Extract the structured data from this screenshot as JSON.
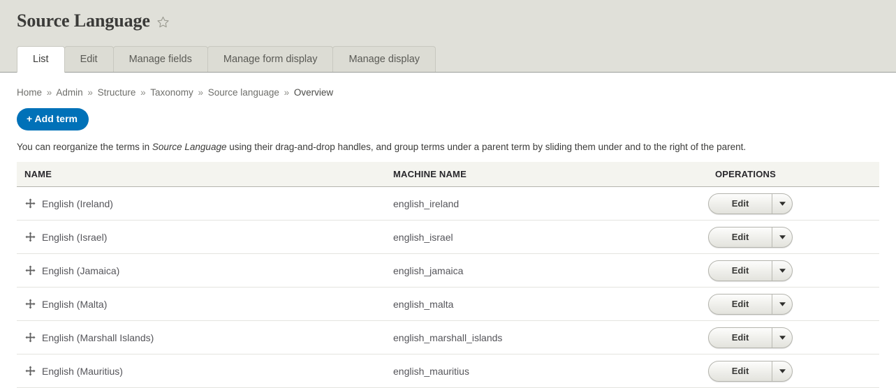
{
  "header": {
    "title": "Source Language",
    "favorite_icon": "star-outline-icon"
  },
  "tabs": [
    {
      "label": "List",
      "active": true
    },
    {
      "label": "Edit",
      "active": false
    },
    {
      "label": "Manage fields",
      "active": false
    },
    {
      "label": "Manage form display",
      "active": false
    },
    {
      "label": "Manage display",
      "active": false
    }
  ],
  "breadcrumb": {
    "separator": "»",
    "items": [
      "Home",
      "Admin",
      "Structure",
      "Taxonomy",
      "Source language",
      "Overview"
    ]
  },
  "actions": {
    "add_term_label": "+ Add term",
    "add_term_color": "#0071b8"
  },
  "help": {
    "before": "You can reorganize the terms in ",
    "emphasis": "Source Language",
    "after": " using their drag-and-drop handles, and group terms under a parent term by sliding them under and to the right of the parent."
  },
  "table": {
    "columns": [
      "NAME",
      "MACHINE NAME",
      "OPERATIONS"
    ],
    "drag_icon": "move-cross-icon",
    "operation_label": "Edit",
    "operation_toggle_icon": "chevron-down-icon",
    "rows": [
      {
        "name": "English (Ireland)",
        "machine_name": "english_ireland"
      },
      {
        "name": "English (Israel)",
        "machine_name": "english_israel"
      },
      {
        "name": "English (Jamaica)",
        "machine_name": "english_jamaica"
      },
      {
        "name": "English (Malta)",
        "machine_name": "english_malta"
      },
      {
        "name": "English (Marshall Islands)",
        "machine_name": "english_marshall_islands"
      },
      {
        "name": "English (Mauritius)",
        "machine_name": "english_mauritius"
      }
    ]
  }
}
